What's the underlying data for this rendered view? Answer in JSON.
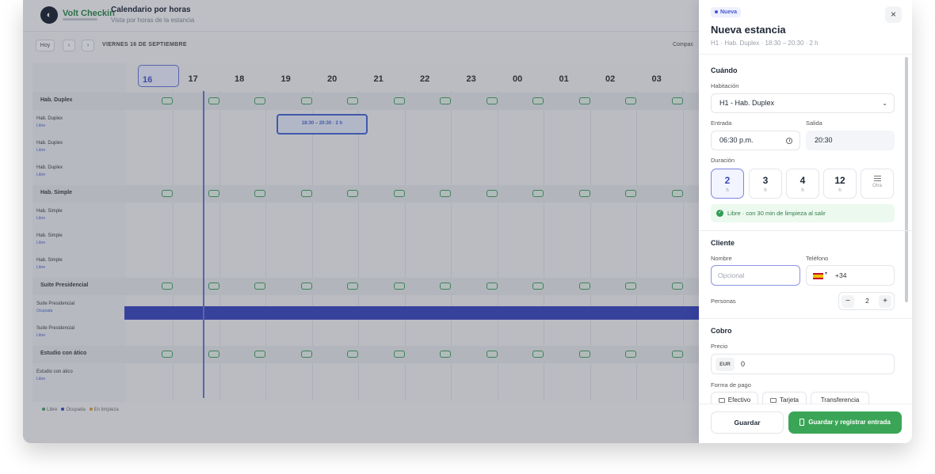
{
  "app": {
    "brand": "Volt Checkin",
    "title": "Calendario por horas",
    "subtitle": "Vista por horas de la estancia"
  },
  "toolbar": {
    "today_label": "Hoy",
    "prev_label": "‹",
    "next_label": "›",
    "date_label": "VIERNES 16 DE SEPTIEMBRE",
    "right_label": "Compac"
  },
  "timeline": {
    "hours": [
      "16",
      "17",
      "18",
      "19",
      "20",
      "21",
      "22",
      "23",
      "00",
      "01",
      "02",
      "03"
    ],
    "today_hour": "16"
  },
  "groups": [
    {
      "label": "Hab. Duplex",
      "rooms": [
        {
          "name": "Hab. Duplex",
          "status": "Libre"
        },
        {
          "name": "Hab. Duplex",
          "status": "Libre"
        },
        {
          "name": "Hab. Duplex",
          "status": "Libre"
        }
      ]
    },
    {
      "label": "Hab. Simple",
      "rooms": [
        {
          "name": "Hab. Simple",
          "status": "Libre"
        },
        {
          "name": "Hab. Simple",
          "status": "Libre"
        },
        {
          "name": "Hab. Simple",
          "status": "Libre"
        }
      ]
    },
    {
      "label": "Suite Presidencial",
      "rooms": [
        {
          "name": "Suite Presidencial",
          "status": "Ocupada"
        },
        {
          "name": "Suite Presidencial",
          "status": "Libre"
        }
      ]
    },
    {
      "label": "Estudio con ático",
      "rooms": [
        {
          "name": "Estudio con ático",
          "status": "Libre"
        }
      ]
    }
  ],
  "selection_label": "18:30 – 20:30 · 2 h",
  "legend": [
    "Libre",
    "Ocupada",
    "En limpieza"
  ],
  "drawer": {
    "badge": "Nueva",
    "title": "Nueva estancia",
    "subtitle": "H1 · Hab. Duplex · 18:30 – 20:30 · 2 h",
    "close_label": "×",
    "when": {
      "section": "Cuándo",
      "room_label": "Habitación",
      "room_value": "H1 - Hab. Duplex",
      "checkin_label": "Entrada",
      "checkin_value": "06:30 p.m.",
      "checkout_label": "Salida",
      "checkout_value": "20:30",
      "duration_label": "Duración",
      "durations": [
        {
          "value": "2",
          "unit": "h"
        },
        {
          "value": "3",
          "unit": "h"
        },
        {
          "value": "4",
          "unit": "h"
        },
        {
          "value": "12",
          "unit": "h"
        }
      ],
      "duration_other": "Otra",
      "availability": "Libre · con 30 min de limpieza al salir"
    },
    "client": {
      "section": "Cliente",
      "name_label": "Nombre",
      "name_placeholder": "Opcional",
      "phone_label": "Teléfono",
      "phone_code": "+34",
      "persons_label": "Personas",
      "persons_value": "2",
      "minus": "−",
      "plus": "+"
    },
    "billing": {
      "section": "Cobro",
      "price_label": "Precio",
      "currency": "EUR",
      "price_value": "0",
      "payment_label": "Forma de pago",
      "payment_methods": [
        "Efectivo",
        "Tarjeta",
        "Transferencia"
      ]
    },
    "footer": {
      "save_label": "Guardar",
      "checkin_label": "Guardar y registrar entrada"
    }
  },
  "colors": {
    "accent": "#4a58c9",
    "success": "#3aa557",
    "occupied": "#3d4cc2"
  }
}
